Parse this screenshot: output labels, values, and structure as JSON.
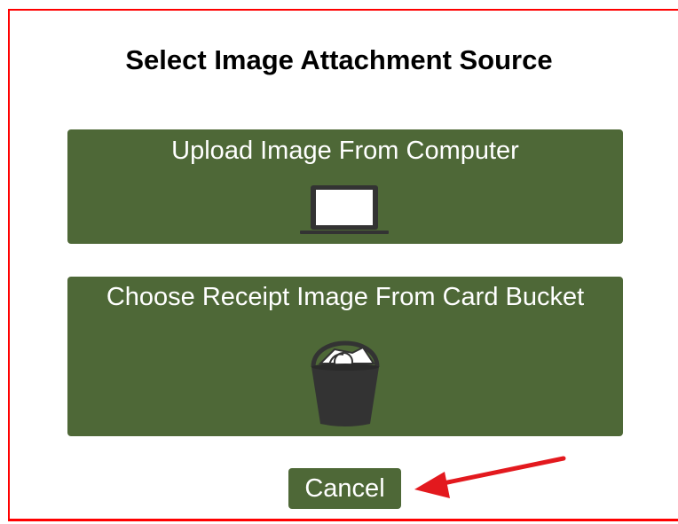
{
  "dialog": {
    "title": "Select Image Attachment Source",
    "options": [
      {
        "label": "Upload Image From Computer",
        "icon": "laptop-icon"
      },
      {
        "label": "Choose Receipt Image From Card Bucket",
        "icon": "bucket-icon"
      }
    ],
    "cancel_label": "Cancel"
  },
  "colors": {
    "button_green": "#4e6837",
    "frame_red": "#ff0000",
    "arrow_red": "#e3191e",
    "icon_dark": "#333333"
  }
}
